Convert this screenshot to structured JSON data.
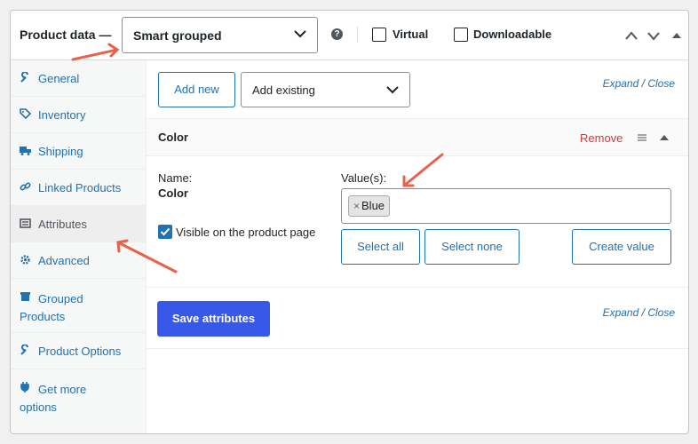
{
  "header": {
    "title": "Product data —",
    "product_type": "Smart grouped",
    "help": "?",
    "virtual_label": "Virtual",
    "downloadable_label": "Downloadable"
  },
  "sidebar": {
    "items": [
      {
        "label": "General",
        "icon": "wrench-icon"
      },
      {
        "label": "Inventory",
        "icon": "tag-icon"
      },
      {
        "label": "Shipping",
        "icon": "truck-icon"
      },
      {
        "label": "Linked Products",
        "icon": "link-icon"
      },
      {
        "label": "Attributes",
        "icon": "list-icon",
        "active": true
      },
      {
        "label": "Advanced",
        "icon": "gear-icon"
      },
      {
        "label": "Grouped Products",
        "icon": "box-icon"
      },
      {
        "label": "Product Options",
        "icon": "wrench-icon"
      },
      {
        "label": "Get more options",
        "icon": "plug-icon"
      }
    ]
  },
  "toolbar": {
    "add_new": "Add new",
    "add_existing": "Add existing",
    "expand": "Expand",
    "slash": "/",
    "close": "Close"
  },
  "attribute": {
    "title": "Color",
    "remove": "Remove",
    "name_label": "Name:",
    "name_value": "Color",
    "values_label": "Value(s):",
    "token": "Blue",
    "token_remove": "×",
    "visible_label": "Visible on the product page",
    "visible_checked": true,
    "select_all": "Select all",
    "select_none": "Select none",
    "create_value": "Create value"
  },
  "footer": {
    "save": "Save attributes",
    "expand": "Expand",
    "slash": "/",
    "close": "Close"
  },
  "colors": {
    "link": "#2271b1",
    "primary": "#3858e9",
    "remove": "#d63638",
    "annotation_arrow": "#e8624a"
  }
}
